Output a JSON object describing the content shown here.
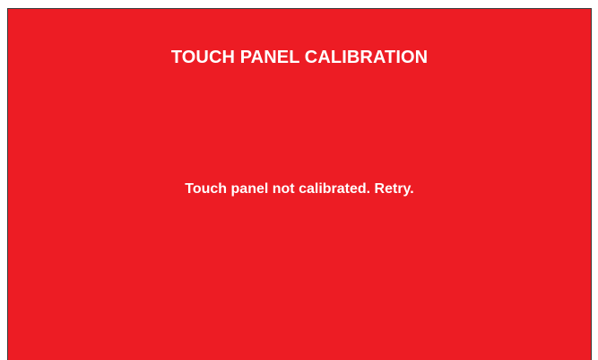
{
  "screen": {
    "background_color": "#ed1c24",
    "text_color": "#ffffff",
    "title": "TOUCH PANEL CALIBRATION",
    "message": "Touch panel not calibrated. Retry."
  }
}
